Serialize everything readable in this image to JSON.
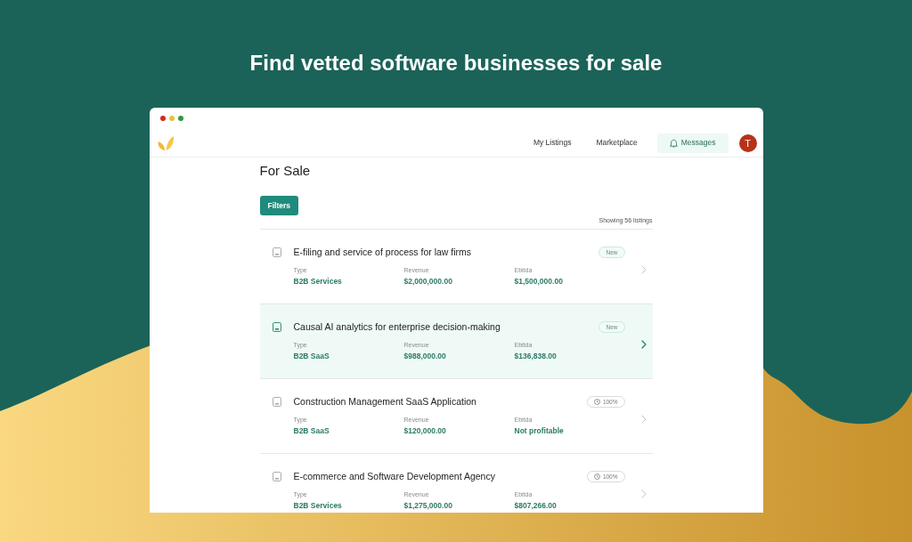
{
  "headline": "Find vetted software businesses for sale",
  "window": {
    "navbar": {
      "items": [
        {
          "label": "My Listings",
          "kind": "link",
          "selected": false
        },
        {
          "label": "Marketplace",
          "kind": "link",
          "selected": false
        },
        {
          "label": "Messages",
          "kind": "bell",
          "selected": true
        }
      ],
      "avatar": {
        "initial": "T"
      }
    },
    "page": {
      "title": "For Sale",
      "filter_button": "Filters",
      "result_count": "Showing 56 listings",
      "listings": [
        {
          "title": "E-filing and service of process for law firms",
          "selected": false,
          "badge": {
            "kind": "new",
            "label": "New"
          },
          "fields": [
            {
              "label": "Type",
              "value": "B2B Services"
            },
            {
              "label": "Revenue",
              "value": "$2,000,000.00"
            },
            {
              "label": "Ebitda",
              "value": "$1,500,000.00"
            }
          ]
        },
        {
          "title": "Causal AI analytics for enterprise decision-making",
          "selected": true,
          "badge": {
            "kind": "new",
            "label": "New"
          },
          "fields": [
            {
              "label": "Type",
              "value": "B2B SaaS"
            },
            {
              "label": "Revenue",
              "value": "$988,000.00"
            },
            {
              "label": "Ebitda",
              "value": "$136,838.00"
            }
          ]
        },
        {
          "title": "Construction Management SaaS Application",
          "selected": false,
          "badge": {
            "kind": "completion",
            "label": "100%"
          },
          "fields": [
            {
              "label": "Type",
              "value": "B2B SaaS"
            },
            {
              "label": "Revenue",
              "value": "$120,000.00"
            },
            {
              "label": "Ebitda",
              "value": "Not profitable"
            }
          ]
        },
        {
          "title": "E-commerce and Software Development Agency",
          "selected": false,
          "badge": {
            "kind": "completion",
            "label": "100%"
          },
          "fields": [
            {
              "label": "Type",
              "value": "B2B Services"
            },
            {
              "label": "Revenue",
              "value": "$1,275,000.00"
            },
            {
              "label": "Ebitda",
              "value": "$807,266.00"
            }
          ]
        }
      ]
    }
  }
}
